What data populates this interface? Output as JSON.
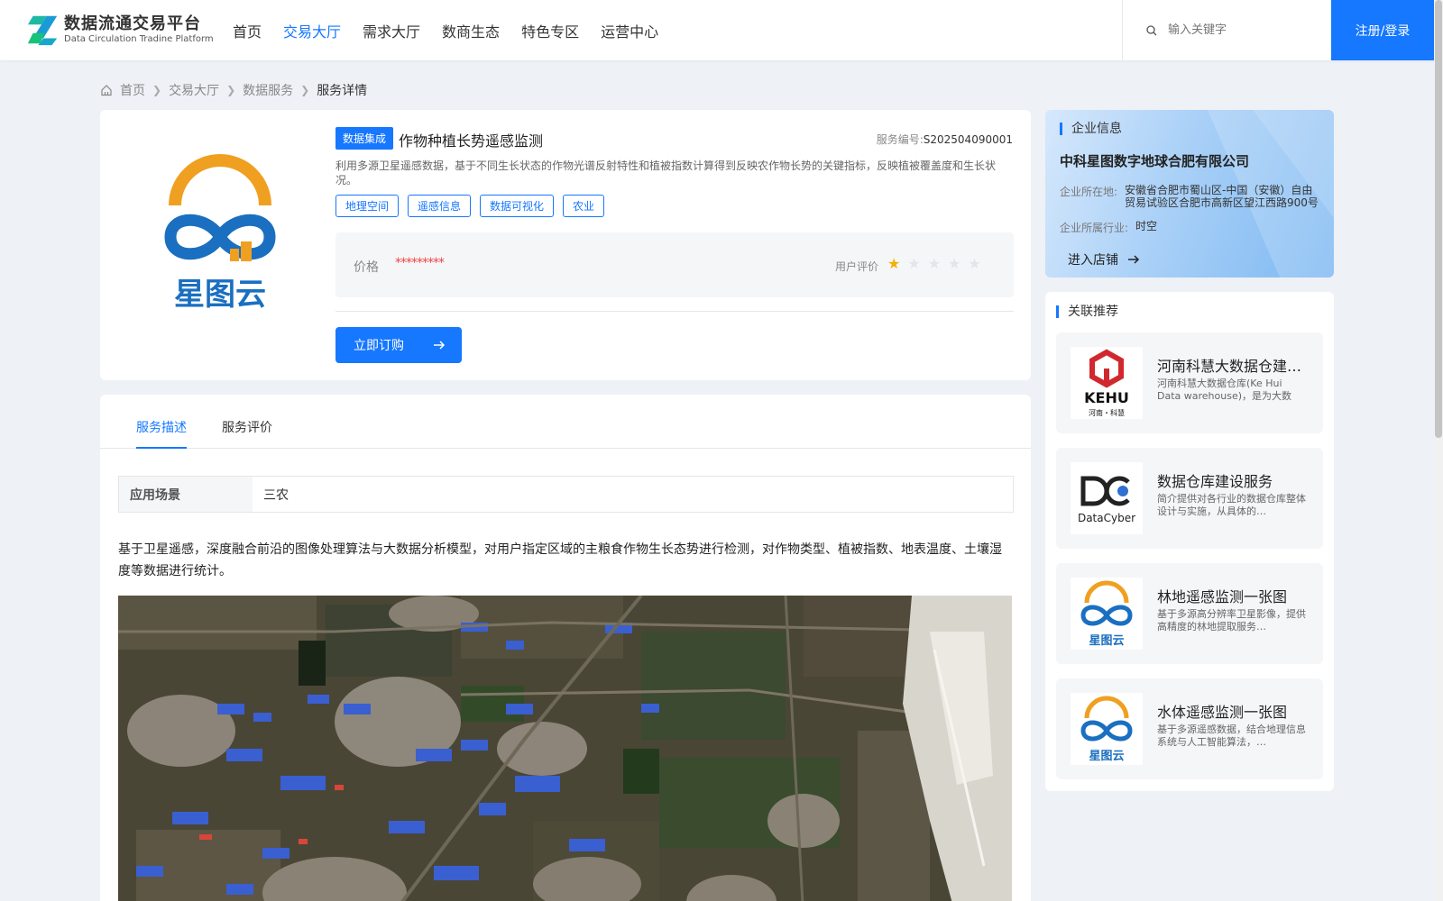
{
  "header": {
    "logo_title": "数据流通交易平台",
    "logo_subtitle": "Data Circulation Tradine Platform",
    "nav": [
      "首页",
      "交易大厅",
      "需求大厅",
      "数商生态",
      "特色专区",
      "运营中心"
    ],
    "active_nav": "交易大厅",
    "search_placeholder": "输入关键字",
    "login_label": "注册/登录"
  },
  "breadcrumb": {
    "home": "首页",
    "level1": "交易大厅",
    "level2": "数据服务",
    "current": "服务详情"
  },
  "product": {
    "category_tag": "数据集成",
    "title": "作物种植长势遥感监测",
    "service_no_label": "服务编号:",
    "service_no": "S202504090001",
    "description": "利用多源卫星遥感数据，基于不同生长状态的作物光谱反射特性和植被指数计算得到反映农作物长势的关键指标，反映植被覆盖度和生长状况。",
    "tags": [
      "地理空间",
      "遥感信息",
      "数据可视化",
      "农业"
    ],
    "price_label": "价格",
    "price_value": "*********",
    "rating_label": "用户评价",
    "rating": 1,
    "rating_max": 5,
    "buy_label": "立即订购",
    "logo_text": "星图云",
    "colors": {
      "accent": "#1677ff",
      "price": "#ef4444",
      "star": "#f5b000"
    }
  },
  "detail": {
    "tabs": [
      "服务描述",
      "服务评价"
    ],
    "active_tab": "服务描述",
    "scene_label": "应用场景",
    "scene_value": "三农",
    "text": "基于卫星遥感，深度融合前沿的图像处理算法与大数据分析模型，对用户指定区域的主粮食作物生长态势进行检测，对作物类型、植被指数、地表温度、土壤湿度等数据进行统计。"
  },
  "company": {
    "section_title": "企业信息",
    "name": "中科星图数字地球合肥有限公司",
    "location_label": "企业所在地:",
    "location": "安徽省合肥市蜀山区-中国（安徽）自由贸易试验区合肥市高新区望江西路900号",
    "industry_label": "企业所属行业:",
    "industry": "时空",
    "enter_label": "进入店铺"
  },
  "related": {
    "section_title": "关联推荐",
    "items": [
      {
        "title": "河南科慧大数据仓建设服务",
        "desc": "河南科慧大数据仓库(Ke Hui Data warehouse)，是为大数据…",
        "thumb": "kehui-logo",
        "thumb_text": "KEHU",
        "thumb_sub": "河南・科慧"
      },
      {
        "title": "数据仓库建设服务",
        "desc": "简介提供对各行业的数据仓库整体设计与实施，从具体的…",
        "thumb": "datacyber-logo",
        "thumb_text": "DataCyber"
      },
      {
        "title": "林地遥感监测一张图",
        "desc": "基于多源高分辨率卫星影像，提供高精度的林地提取服务…",
        "thumb": "xingtuyun-logo",
        "thumb_text": "星图云"
      },
      {
        "title": "水体遥感监测一张图",
        "desc": "基于多源遥感数据，结合地理信息系统与人工智能算法，…",
        "thumb": "xingtuyun-logo",
        "thumb_text": "星图云"
      }
    ]
  }
}
